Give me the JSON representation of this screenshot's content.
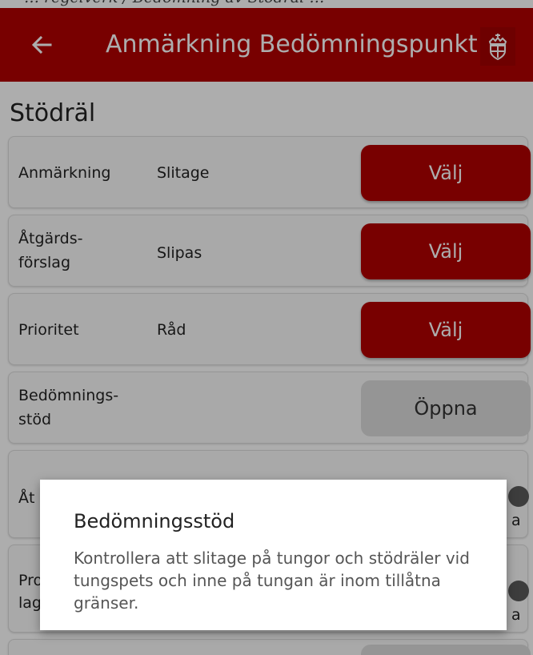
{
  "header_strip_text": "… regelverk / Bedömning av Stödräl …",
  "appbar": {
    "title": "Anmärkning Bedömningspunkt",
    "back_icon": "arrow-left-icon",
    "logo_icon": "crown-emblem-icon",
    "color": "#b20000"
  },
  "section": {
    "title": "Stödräl"
  },
  "rows": [
    {
      "label": "Anmärkning",
      "value": "Slitage",
      "button": "Välj"
    },
    {
      "label": "Åtgärds-\nförslag",
      "value": "Slipas",
      "button": "Välj"
    },
    {
      "label": "Prioritet",
      "value": "Råd",
      "button": "Välj"
    },
    {
      "label": "Bedömnings-\nstöd",
      "value": "",
      "button": "Öppna"
    }
  ],
  "partial_rows": [
    {
      "label_fragment": "Åt",
      "trailing_fragment": "a"
    },
    {
      "label_fragment": "Pro\nlag",
      "trailing_fragment": "a"
    }
  ],
  "dialog": {
    "title": "Bedömningsstöd",
    "body": "Kontrollera att slitage på tungor och stödräler vid tungspets och inne på tungan är inom tillåtna gränser."
  }
}
